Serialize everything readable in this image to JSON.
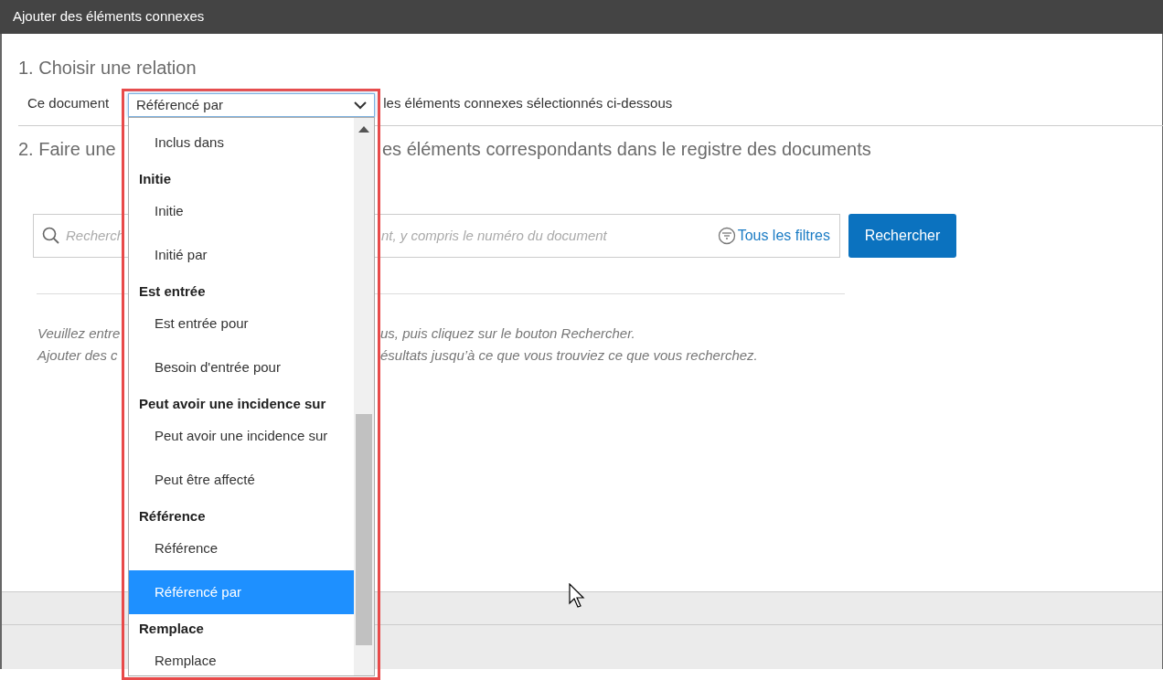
{
  "window": {
    "title": "Ajouter des éléments connexes"
  },
  "step1": {
    "heading": "1. Choisir une relation",
    "prefix": "Ce document",
    "suffix": "les éléments connexes sélectionnés ci-dessous"
  },
  "relation_select": {
    "value": "Référencé par",
    "expanded": true,
    "options": [
      {
        "kind": "option",
        "label": "Inclus dans",
        "selected": false
      },
      {
        "kind": "group",
        "label": "Initie"
      },
      {
        "kind": "option",
        "label": "Initie",
        "selected": false
      },
      {
        "kind": "option",
        "label": "Initié par",
        "selected": false
      },
      {
        "kind": "group",
        "label": "Est entrée"
      },
      {
        "kind": "option",
        "label": "Est entrée pour",
        "selected": false
      },
      {
        "kind": "option",
        "label": "Besoin d'entrée pour",
        "selected": false
      },
      {
        "kind": "group",
        "label": "Peut avoir une incidence sur"
      },
      {
        "kind": "option",
        "label": "Peut avoir une incidence sur",
        "selected": false
      },
      {
        "kind": "option",
        "label": "Peut être affecté",
        "selected": false
      },
      {
        "kind": "group",
        "label": "Référence"
      },
      {
        "kind": "option",
        "label": "Référence",
        "selected": false
      },
      {
        "kind": "option",
        "label": "Référencé par",
        "selected": true
      },
      {
        "kind": "group",
        "label": "Remplace"
      },
      {
        "kind": "option",
        "label": "Remplace",
        "selected": false
      }
    ]
  },
  "step2": {
    "heading_start": "2. Faire une",
    "heading_end": "es éléments correspondants dans le registre des documents"
  },
  "search": {
    "placeholder_start": "Recherch",
    "placeholder_end": "nt, y compris le numéro du document",
    "filters_link": "Tous les filtres",
    "button": "Rechercher"
  },
  "hint_lines": [
    {
      "start": "Veuillez entre",
      "end": "us, puis cliquez sur le bouton Rechercher."
    },
    {
      "start": "Ajouter des c",
      "end": "ésultats jusqu’à ce que vous trouviez ce que vous recherchez."
    }
  ]
}
